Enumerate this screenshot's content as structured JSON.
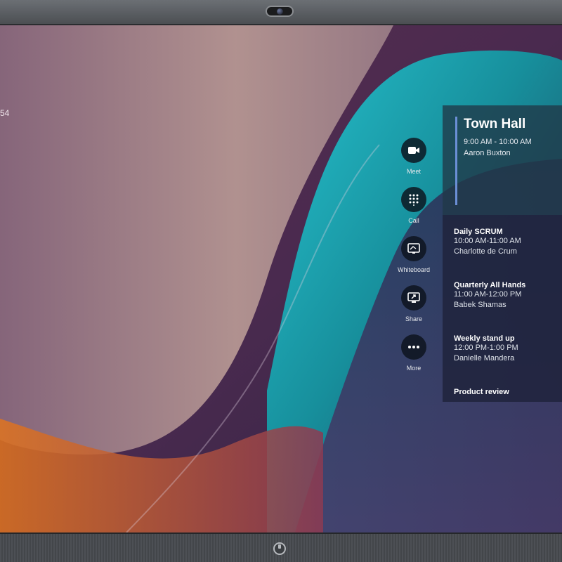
{
  "status": {
    "clock_fragment": "54"
  },
  "actions": [
    {
      "label": "Meet",
      "icon": "video-camera-icon"
    },
    {
      "label": "Call",
      "icon": "dialpad-icon"
    },
    {
      "label": "Whiteboard",
      "icon": "whiteboard-icon"
    },
    {
      "label": "Share",
      "icon": "share-screen-icon"
    },
    {
      "label": "More",
      "icon": "more-dots-icon"
    }
  ],
  "agenda": {
    "current": {
      "title": "Town Hall",
      "time": "9:00 AM - 10:00 AM",
      "host": "Aaron Buxton"
    },
    "upcoming": [
      {
        "title": "Daily SCRUM",
        "time": "10:00 AM-11:00 AM",
        "host": "Charlotte de Crum"
      },
      {
        "title": "Quarterly All Hands",
        "time": "11:00 AM-12:00 PM",
        "host": "Babek Shamas"
      },
      {
        "title": "Weekly stand up",
        "time": "12:00 PM-1:00 PM",
        "host": "Danielle Mandera"
      },
      {
        "title": "Product review"
      }
    ]
  },
  "colors": {
    "accent_bar": "#6b8fd6",
    "wallpaper_teal": "#1aa6b3",
    "wallpaper_purple": "#6a3a6c",
    "wallpaper_orange": "#d4651e"
  }
}
